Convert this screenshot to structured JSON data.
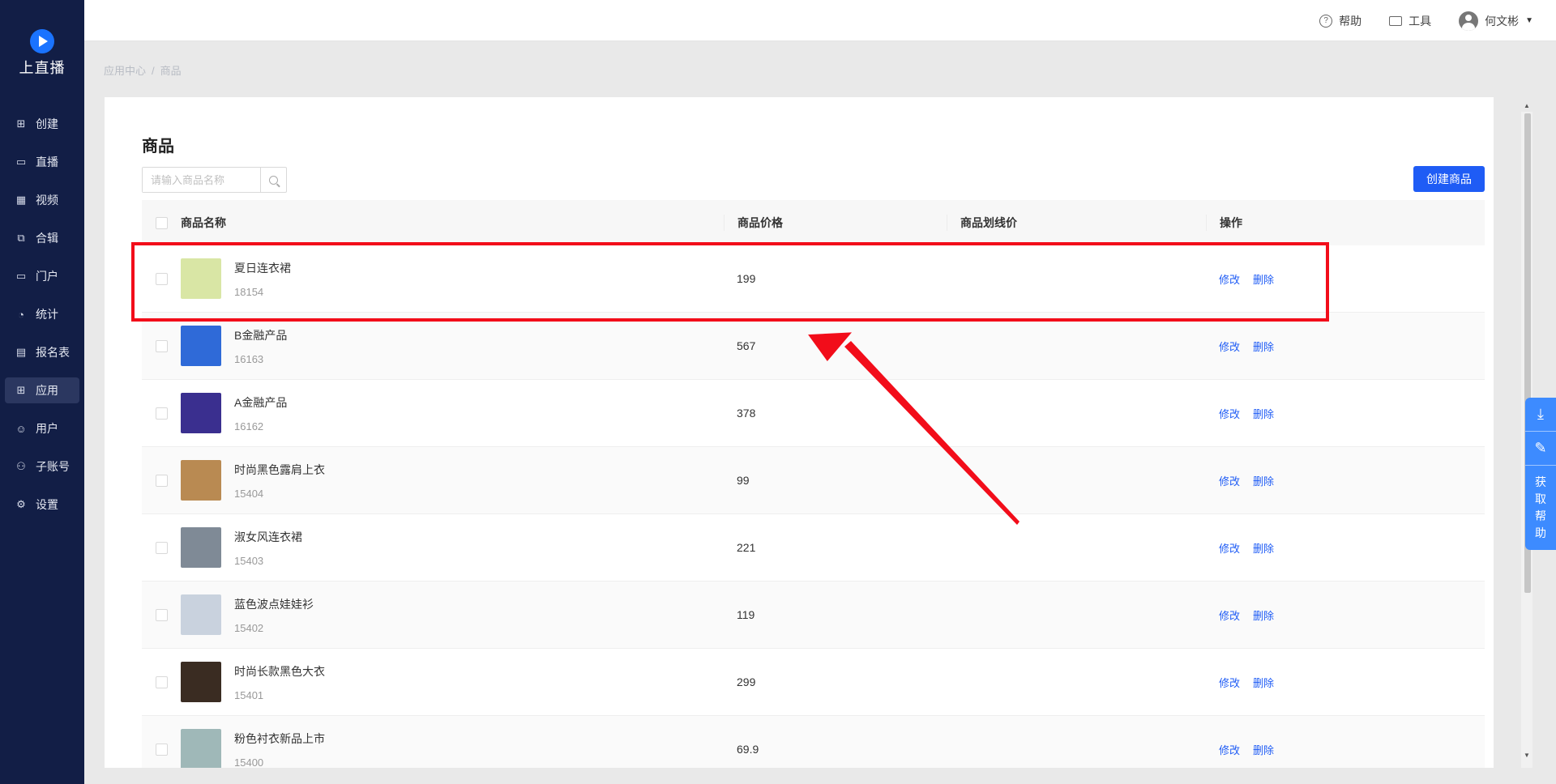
{
  "app": {
    "logo_text": "上直播"
  },
  "sidebar": {
    "items": [
      {
        "label": "创建",
        "icon": "plus-square-icon",
        "active": false
      },
      {
        "label": "直播",
        "icon": "video-camera-icon",
        "active": false
      },
      {
        "label": "视频",
        "icon": "film-icon",
        "active": false
      },
      {
        "label": "合辑",
        "icon": "collection-icon",
        "active": false
      },
      {
        "label": "门户",
        "icon": "monitor-icon",
        "active": false
      },
      {
        "label": "统计",
        "icon": "pie-chart-icon",
        "active": false
      },
      {
        "label": "报名表",
        "icon": "form-icon",
        "active": false
      },
      {
        "label": "应用",
        "icon": "grid-icon",
        "active": true
      },
      {
        "label": "用户",
        "icon": "users-icon",
        "active": false
      },
      {
        "label": "子账号",
        "icon": "sub-account-icon",
        "active": false
      },
      {
        "label": "设置",
        "icon": "gear-icon",
        "active": false
      }
    ]
  },
  "topbar": {
    "help_label": "帮助",
    "tools_label": "工具",
    "user_name": "何文彬"
  },
  "breadcrumb": {
    "parent": "应用中心",
    "separator": "/",
    "current": "商品"
  },
  "page": {
    "title": "商品",
    "search_placeholder": "请输入商品名称",
    "create_button": "创建商品"
  },
  "table": {
    "columns": {
      "name": "商品名称",
      "price": "商品价格",
      "strike_price": "商品划线价",
      "ops": "操作"
    },
    "edit_label": "修改",
    "delete_label": "删除",
    "rows": [
      {
        "name": "夏日连衣裙",
        "id": "18154",
        "price": "199",
        "strike": "",
        "thumb_color": "#d9e6a5"
      },
      {
        "name": "B金融产品",
        "id": "16163",
        "price": "567",
        "strike": "",
        "thumb_color": "#2f6ad8"
      },
      {
        "name": "A金融产品",
        "id": "16162",
        "price": "378",
        "strike": "",
        "thumb_color": "#3a2f8f"
      },
      {
        "name": "时尚黑色露肩上衣",
        "id": "15404",
        "price": "99",
        "strike": "",
        "thumb_color": "#b98a52"
      },
      {
        "name": "淑女风连衣裙",
        "id": "15403",
        "price": "221",
        "strike": "",
        "thumb_color": "#7f8a96"
      },
      {
        "name": "蓝色波点娃娃衫",
        "id": "15402",
        "price": "119",
        "strike": "",
        "thumb_color": "#c9d2de"
      },
      {
        "name": "时尚长款黑色大衣",
        "id": "15401",
        "price": "299",
        "strike": "",
        "thumb_color": "#3a2c22"
      },
      {
        "name": "粉色衬衣新品上市",
        "id": "15400",
        "price": "69.9",
        "strike": "",
        "thumb_color": "#9fb8b8"
      }
    ]
  },
  "help_float": {
    "text": "获取帮助"
  },
  "colors": {
    "sidebar_bg": "#121e46",
    "primary": "#1f5cf5",
    "annotation": "#f20d1a"
  }
}
